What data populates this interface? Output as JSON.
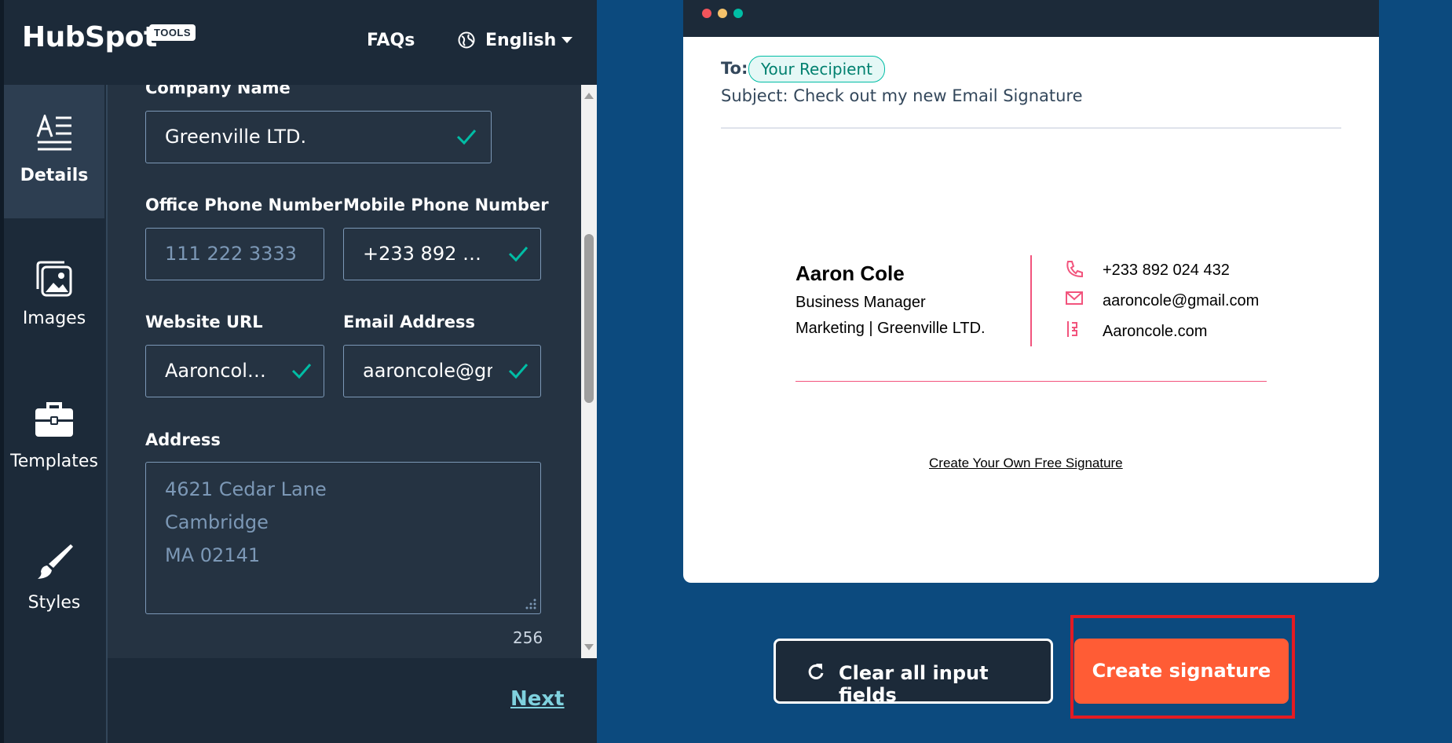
{
  "header": {
    "logo_text": "HubSpot",
    "logo_badge": "TOOLS",
    "faqs": "FAQs",
    "language": "English"
  },
  "sidebar": {
    "items": [
      {
        "label": "Details",
        "icon": "details-icon",
        "active": true
      },
      {
        "label": "Images",
        "icon": "images-icon",
        "active": false
      },
      {
        "label": "Templates",
        "icon": "briefcase-icon",
        "active": false
      },
      {
        "label": "Styles",
        "icon": "brush-icon",
        "active": false
      }
    ]
  },
  "form": {
    "company_name_label": "Company Name",
    "company_name_value": "Greenville LTD.",
    "office_phone_label": "Office Phone Number",
    "office_phone_placeholder": "111 222 3333",
    "mobile_phone_label": "Mobile Phone Number",
    "mobile_phone_value": "+233 892 024...",
    "website_label": "Website URL",
    "website_value": "Aaroncole....",
    "email_label": "Email Address",
    "email_value": "aaroncole@gm",
    "address_label": "Address",
    "address_placeholder_lines": [
      "4621 Cedar Lane",
      "Cambridge",
      "MA 02141"
    ],
    "address_char_count": "256",
    "next_label": "Next"
  },
  "preview": {
    "to_label": "To:",
    "recipient": "Your Recipient",
    "subject_label": "Subject:",
    "subject": "Check out my new Email Signature",
    "signature": {
      "name": "Aaron Cole",
      "title": "Business Manager",
      "company_line": "Marketing | Greenville LTD.",
      "phone": "+233 892 024 432",
      "email": "aaroncole@gmail.com",
      "website": "Aaroncole.com"
    },
    "free_signature_link": "Create Your Own Free Signature"
  },
  "actions": {
    "clear_label": "Clear all input fields",
    "create_label": "Create signature"
  },
  "colors": {
    "accent_orange": "#ff5c35",
    "dark_navy": "#1c2a39",
    "background_blue": "#0c4a7e",
    "signature_pink": "#f2547d",
    "check_green": "#00bda5",
    "highlight_red": "#e31b23"
  }
}
